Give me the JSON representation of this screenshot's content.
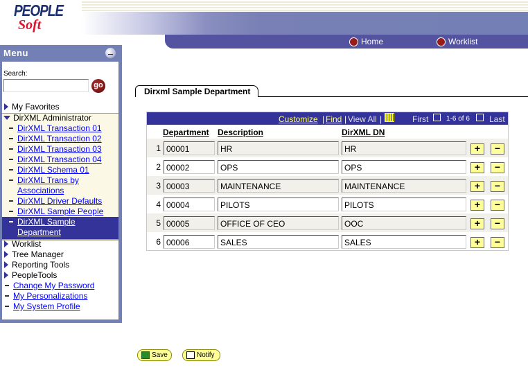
{
  "header": {
    "logo_text": [
      "PEOPLE",
      "Soft"
    ],
    "home": "Home",
    "worklist": "Worklist"
  },
  "menu": {
    "title": "Menu",
    "search_label": "Search:",
    "search_value": "",
    "go": "go",
    "items": [
      {
        "label": "My Favorites",
        "type": "folder"
      },
      {
        "label": "DirXML Administrator",
        "type": "open-folder"
      },
      {
        "label": "DirXML Transaction 01",
        "type": "link"
      },
      {
        "label": "DirXML Transaction 02",
        "type": "link"
      },
      {
        "label": "DirXML Transaction 03",
        "type": "link"
      },
      {
        "label": "DirXML Transaction 04",
        "type": "link"
      },
      {
        "label": "DirXML Schema 01",
        "type": "link"
      },
      {
        "label": "DirXML Trans by Associations",
        "type": "link"
      },
      {
        "label": "DirXML Driver Defaults",
        "type": "link"
      },
      {
        "label": "DirXML Sample People",
        "type": "link"
      },
      {
        "label": "DirXML Sample Department",
        "type": "selected"
      },
      {
        "label": "Worklist",
        "type": "folder"
      },
      {
        "label": "Tree Manager",
        "type": "folder"
      },
      {
        "label": "Reporting Tools",
        "type": "folder"
      },
      {
        "label": "PeopleTools",
        "type": "folder"
      },
      {
        "label": "Change My Password",
        "type": "link"
      },
      {
        "label": "My Personalizations",
        "type": "link"
      },
      {
        "label": "My System Profile",
        "type": "link"
      }
    ]
  },
  "page": {
    "tab": "Dirxml Sample Department"
  },
  "grid": {
    "customize": "Customize",
    "find": "Find",
    "view_all": "View All",
    "first": "First",
    "range": "1-6 of 6",
    "last": "Last",
    "columns": [
      "Department",
      "Description",
      "DirXML DN"
    ],
    "rows": [
      {
        "n": "1",
        "dept": "00001",
        "desc": "HR",
        "dn": "HR"
      },
      {
        "n": "2",
        "dept": "00002",
        "desc": "OPS",
        "dn": "OPS"
      },
      {
        "n": "3",
        "dept": "00003",
        "desc": "MAINTENANCE",
        "dn": "MAINTENANCE"
      },
      {
        "n": "4",
        "dept": "00004",
        "desc": "PILOTS",
        "dn": "PILOTS"
      },
      {
        "n": "5",
        "dept": "00005",
        "desc": "OFFICE OF CEO",
        "dn": "OOC"
      },
      {
        "n": "6",
        "dept": "00006",
        "desc": "SALES",
        "dn": "SALES"
      }
    ],
    "add": "+",
    "remove": "−"
  },
  "footer": {
    "save": "Save",
    "notify": "Notify"
  }
}
